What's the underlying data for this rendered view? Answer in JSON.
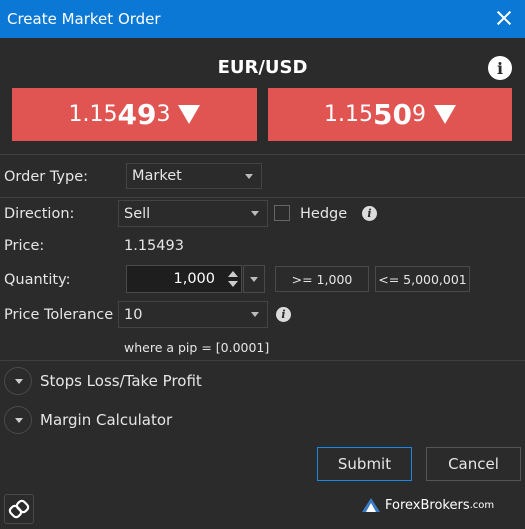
{
  "window": {
    "title": "Create Market Order"
  },
  "instrument": {
    "symbol": "EUR/USD"
  },
  "prices": {
    "sell": {
      "small": "1.15",
      "big": "49",
      "tail": "3"
    },
    "buy": {
      "small": "1.15",
      "big": "50",
      "tail": "9"
    }
  },
  "form": {
    "order_type": {
      "label": "Order Type:",
      "value": "Market"
    },
    "direction": {
      "label": "Direction:",
      "value": "Sell"
    },
    "hedge": {
      "label": "Hedge"
    },
    "price": {
      "label": "Price:",
      "value": "1.15493"
    },
    "quantity": {
      "label": "Quantity:",
      "value": "1,000",
      "min_chip": ">= 1,000",
      "max_chip": "<= 5,000,001"
    },
    "price_tolerance": {
      "label": "Price Tolerance",
      "value": "10",
      "hint": "where a pip = [0.0001]"
    }
  },
  "sections": {
    "stops": "Stops Loss/Take Profit",
    "margin": "Margin Calculator"
  },
  "actions": {
    "submit": "Submit",
    "cancel": "Cancel"
  },
  "watermark": {
    "brand": "ForexBrokers",
    "domain": ".com"
  },
  "colors": {
    "titlebar": "#0a78d4",
    "price_button": "#e05552",
    "background": "#2b2b2b",
    "submit_border": "#1a88e6"
  }
}
